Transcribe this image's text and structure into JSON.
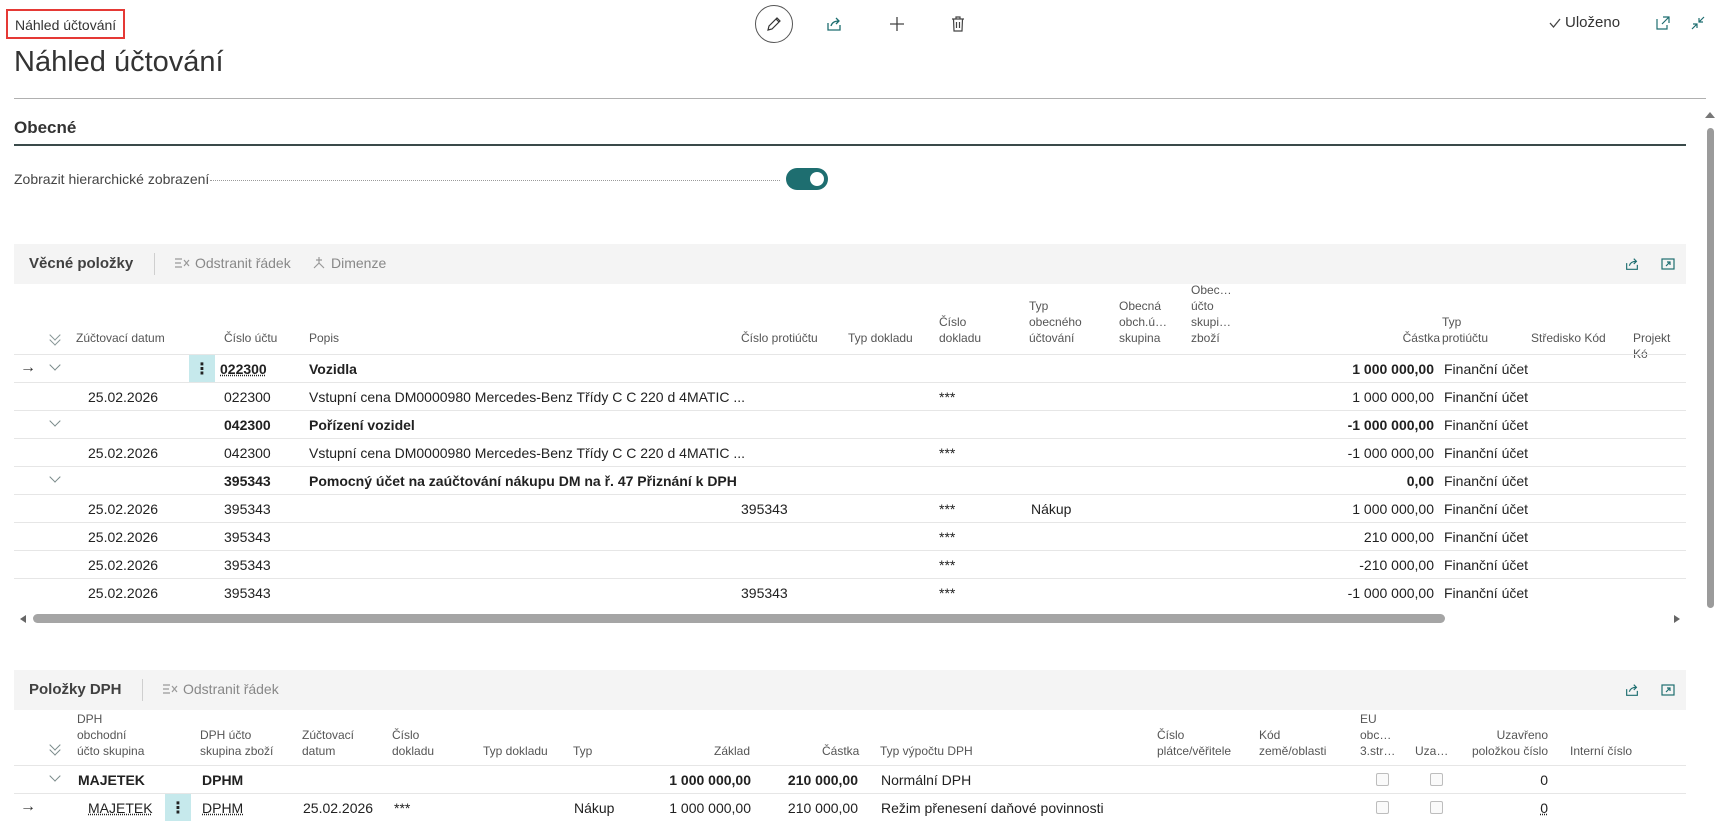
{
  "header": {
    "breadcrumb": "Náhled účtování",
    "title": "Náhled účtování",
    "saved_label": "Uloženo"
  },
  "icons": {
    "edit": "pencil-icon",
    "share": "share-icon",
    "add": "plus-icon",
    "delete": "trash-icon",
    "open_new": "open-in-new-window-icon",
    "collapse": "collapse-icon",
    "saved": "checkmark-icon"
  },
  "colors": {
    "accent": "#1e6e70",
    "highlight": "#c6e9ec",
    "breadcrumb_border": "#e53935"
  },
  "general": {
    "title": "Obecné",
    "hierarchy_label": "Zobrazit hierarchické zobrazení",
    "hierarchy_value": true
  },
  "gl": {
    "title": "Věcné položky",
    "actions": {
      "delete_line": "Odstranit řádek",
      "dimensions": "Dimenze"
    },
    "columns": {
      "posting_date": "Zúčtovací datum",
      "account_no": "Číslo účtu",
      "description": "Popis",
      "bal_account_no": "Číslo protiúčtu",
      "doc_type": "Typ dokladu",
      "doc_no_1": "Číslo",
      "doc_no_2": "dokladu",
      "gen_posting_type_1": "Typ",
      "gen_posting_type_2": "obecného",
      "gen_posting_type_3": "účtování",
      "gen_bus_1": "Obecná",
      "gen_bus_2": "obch.ú…",
      "gen_bus_3": "skupina",
      "gen_prod_1": "Obec…",
      "gen_prod_2": "účto",
      "gen_prod_3": "skupi…",
      "gen_prod_4": "zboží",
      "amount": "Částka",
      "bal_type_1": "Typ",
      "bal_type_2": "protiúčtu",
      "dept_code": "Středisko Kód",
      "project_code": "Projekt Kó"
    },
    "rows": [
      {
        "date": "",
        "account": "022300",
        "description": "Vozidla",
        "bal_account": "",
        "doc_no": "",
        "gen_type": "",
        "amount": "1 000 000,00",
        "bal_type": "Finanční účet"
      },
      {
        "date": "25.02.2026",
        "account": "022300",
        "description": "Vstupní cena DM0000980 Mercedes-Benz Třídy C C 220 d 4MATIC ...",
        "bal_account": "",
        "doc_no": "***",
        "gen_type": "",
        "amount": "1 000 000,00",
        "bal_type": "Finanční účet"
      },
      {
        "date": "",
        "account": "042300",
        "description": "Pořízení vozidel",
        "bal_account": "",
        "doc_no": "",
        "gen_type": "",
        "amount": "-1 000 000,00",
        "bal_type": "Finanční účet"
      },
      {
        "date": "25.02.2026",
        "account": "042300",
        "description": "Vstupní cena DM0000980 Mercedes-Benz Třídy C C 220 d 4MATIC ...",
        "bal_account": "",
        "doc_no": "***",
        "gen_type": "",
        "amount": "-1 000 000,00",
        "bal_type": "Finanční účet"
      },
      {
        "date": "",
        "account": "395343",
        "description": "Pomocný účet na zaúčtování nákupu DM na ř. 47 Přiznání k DPH",
        "bal_account": "",
        "doc_no": "",
        "gen_type": "",
        "amount": "0,00",
        "bal_type": "Finanční účet"
      },
      {
        "date": "25.02.2026",
        "account": "395343",
        "description": "",
        "bal_account": "395343",
        "doc_no": "***",
        "gen_type": "Nákup",
        "amount": "1 000 000,00",
        "bal_type": "Finanční účet"
      },
      {
        "date": "25.02.2026",
        "account": "395343",
        "description": "",
        "bal_account": "",
        "doc_no": "***",
        "gen_type": "",
        "amount": "210 000,00",
        "bal_type": "Finanční účet"
      },
      {
        "date": "25.02.2026",
        "account": "395343",
        "description": "",
        "bal_account": "",
        "doc_no": "***",
        "gen_type": "",
        "amount": "-210 000,00",
        "bal_type": "Finanční účet"
      },
      {
        "date": "25.02.2026",
        "account": "395343",
        "description": "",
        "bal_account": "395343",
        "doc_no": "***",
        "gen_type": "",
        "amount": "-1 000 000,00",
        "bal_type": "Finanční účet"
      }
    ]
  },
  "vat": {
    "title": "Položky DPH",
    "actions": {
      "delete_line": "Odstranit řádek"
    },
    "columns": {
      "bus_1": "DPH",
      "bus_2": "obchodní",
      "bus_3": "účto skupina",
      "prod_1": "DPH účto",
      "prod_2": "skupina zboží",
      "date_1": "Zúčtovací",
      "date_2": "datum",
      "doc_1": "Číslo",
      "doc_2": "dokladu",
      "doc_type": "Typ dokladu",
      "type": "Typ",
      "base": "Základ",
      "amount": "Částka",
      "calc_type": "Typ výpočtu DPH",
      "payer_1": "Číslo",
      "payer_2": "plátce/věřitele",
      "country_1": "Kód",
      "country_2": "země/oblasti",
      "eu_1": "EU",
      "eu_2": "obc…",
      "eu_3": "3.str…",
      "closed": "Uza…",
      "closed_by_1": "Uzavřeno",
      "closed_by_2": "položkou číslo",
      "internal_no": "Interní číslo"
    },
    "rows": [
      {
        "bus": "MAJETEK",
        "prod": "DPHM",
        "date": "",
        "doc": "",
        "type": "",
        "base": "1 000 000,00",
        "amount": "210 000,00",
        "calc_type": "Normální DPH",
        "closed_by": "0"
      },
      {
        "bus": "MAJETEK",
        "prod": "DPHM",
        "date": "25.02.2026",
        "doc": "***",
        "type": "Nákup",
        "base": "1 000 000,00",
        "amount": "210 000,00",
        "calc_type": "Režim přenesení daňové povinnosti",
        "closed_by": "0"
      }
    ]
  }
}
